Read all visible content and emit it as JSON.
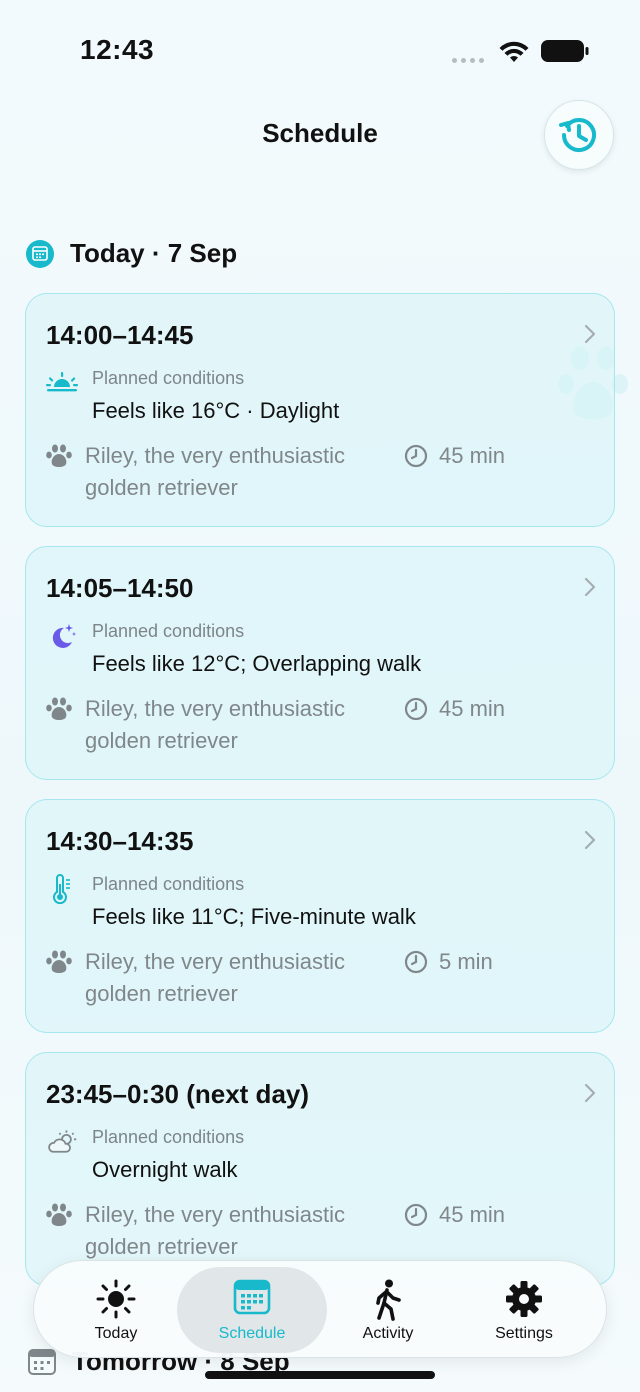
{
  "status": {
    "time": "12:43"
  },
  "header": {
    "title": "Schedule",
    "history_icon": "clock-history-icon"
  },
  "sections": [
    {
      "label": "Today · 7 Sep"
    },
    {
      "label": "Tomorrow · 8 Sep"
    }
  ],
  "walks": [
    {
      "time": "14:00–14:45",
      "condition_icon": "sunrise-icon",
      "cond_label": "Planned conditions",
      "cond_text": "Feels like 16°C · Daylight",
      "dog": "Riley, the very enthusiastic golden retriever",
      "duration": "45 min"
    },
    {
      "time": "14:05–14:50",
      "condition_icon": "moon-stars-icon",
      "cond_label": "Planned conditions",
      "cond_text": "Feels like 12°C; Overlapping walk",
      "dog": "Riley, the very enthusiastic golden retriever",
      "duration": "45 min"
    },
    {
      "time": "14:30–14:35",
      "condition_icon": "thermometer-icon",
      "cond_label": "Planned conditions",
      "cond_text": "Feels like 11°C; Five-minute walk",
      "dog": "Riley, the very enthusiastic golden retriever",
      "duration": "5 min"
    },
    {
      "time": "23:45–0:30 (next day)",
      "condition_icon": "cloud-sun-icon",
      "cond_label": "Planned conditions",
      "cond_text": "Overnight walk",
      "dog": "Riley, the very enthusiastic golden retriever",
      "duration": "45 min"
    }
  ],
  "tabs": [
    {
      "label": "Today",
      "icon": "sun-icon",
      "active": false
    },
    {
      "label": "Schedule",
      "icon": "calendar-icon",
      "active": true
    },
    {
      "label": "Activity",
      "icon": "walking-icon",
      "active": false
    },
    {
      "label": "Settings",
      "icon": "gear-icon",
      "active": false
    }
  ],
  "colors": {
    "accent": "#17b9cb",
    "card_border": "#a6e6ed",
    "card_bg": "#d5f4f8",
    "moon": "#6a5ae8",
    "muted_text": "#80878b"
  }
}
